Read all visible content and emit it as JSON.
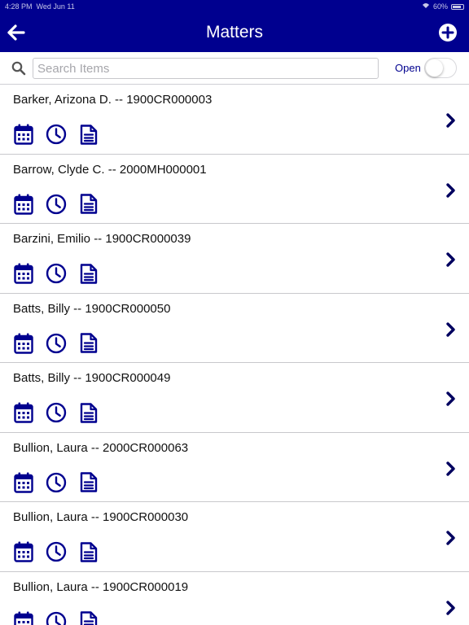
{
  "status_bar": {
    "time": "4:28 PM",
    "date": "Wed Jun 11",
    "battery": "60%"
  },
  "nav": {
    "title": "Matters",
    "back_icon": "arrow-left-icon",
    "add_icon": "plus-circle-icon"
  },
  "search": {
    "placeholder": "Search Items",
    "value": "",
    "icon": "search-icon",
    "open_label": "Open",
    "open_toggle_on": false
  },
  "matters": [
    {
      "title": "Barker, Arizona D. -- 1900CR000003"
    },
    {
      "title": "Barrow, Clyde C. -- 2000MH000001"
    },
    {
      "title": "Barzini, Emilio -- 1900CR000039"
    },
    {
      "title": "Batts, Billy -- 1900CR000050"
    },
    {
      "title": "Batts, Billy -- 1900CR000049"
    },
    {
      "title": "Bullion, Laura -- 2000CR000063"
    },
    {
      "title": "Bullion, Laura -- 1900CR000030"
    },
    {
      "title": "Bullion, Laura -- 1900CR000019"
    }
  ],
  "row_icons": [
    "calendar-icon",
    "clock-icon",
    "document-icon"
  ],
  "colors": {
    "brand": "#00008f",
    "separator": "#c8c8cc"
  }
}
